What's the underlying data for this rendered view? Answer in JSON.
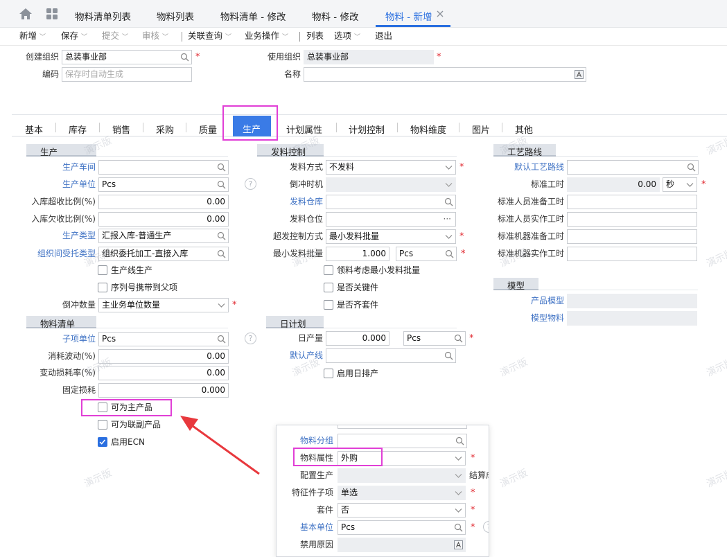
{
  "tabbar": {
    "home_icon": "home-icon",
    "apps_icon": "grid-icon",
    "tabs": [
      {
        "label": "物料清单列表"
      },
      {
        "label": "物料列表"
      },
      {
        "label": "物料清单 - 修改"
      },
      {
        "label": "物料 - 修改"
      },
      {
        "label": "物料 - 新增"
      }
    ],
    "active_color": "#2a6fe0"
  },
  "toolbar": {
    "new": "新增",
    "save": "保存",
    "submit": "提交",
    "audit": "审核",
    "related": "关联查询",
    "business": "业务操作",
    "list": "列表",
    "options": "选项",
    "exit": "退出"
  },
  "header": {
    "create_org_label": "创建组织",
    "create_org_value": "总装事业部",
    "use_org_label": "使用组织",
    "use_org_value": "总装事业部",
    "code_label": "编码",
    "code_placeholder": "保存时自动生成",
    "name_label": "名称",
    "name_value": ""
  },
  "detail_tabs": [
    "基本",
    "库存",
    "销售",
    "采购",
    "质量",
    "生产",
    "计划属性",
    "计划控制",
    "物料维度",
    "图片",
    "其他"
  ],
  "production": {
    "section": "生产",
    "workshop_label": "生产车间",
    "unit_label": "生产单位",
    "unit_value": "Pcs",
    "over_ratio_label": "入库超收比例(%)",
    "over_ratio_value": "0.00",
    "under_ratio_label": "入库欠收比例(%)",
    "under_ratio_value": "0.00",
    "type_label": "生产类型",
    "type_value": "汇报入库-普通生产",
    "inter_org_label": "组织间受托类型",
    "inter_org_value": "组织委托加工-直接入库",
    "line_prod": "生产线生产",
    "serial_carry": "序列号携带到父项",
    "backflush_qty_label": "倒冲数量",
    "backflush_qty_value": "主业务单位数量"
  },
  "bom": {
    "section": "物料清单",
    "child_unit_label": "子项单位",
    "child_unit_value": "Pcs",
    "consume_label": "消耗波动(%)",
    "consume_value": "0.00",
    "variable_loss_label": "变动损耗率(%)",
    "variable_loss_value": "0.00",
    "fixed_loss_label": "固定损耗",
    "fixed_loss_value": "0.000",
    "main_product": "可为主产品",
    "co_product": "可为联副产品",
    "enable_ecn": "启用ECN"
  },
  "issue": {
    "section": "发料控制",
    "method_label": "发料方式",
    "method_value": "不发料",
    "backflush_time_label": "倒冲时机",
    "warehouse_label": "发料仓库",
    "location_label": "发料仓位",
    "location_value": "···",
    "over_control_label": "超发控制方式",
    "over_control_value": "最小发料批量",
    "min_batch_label": "最小发料批量",
    "min_batch_value": "1.000",
    "min_batch_unit": "Pcs",
    "consider_min": "领料考虑最小发料批量",
    "is_key": "是否关键件",
    "is_kit": "是否齐套件"
  },
  "daily": {
    "section": "日计划",
    "daily_output_label": "日产量",
    "daily_output_value": "0.000",
    "daily_output_unit": "Pcs",
    "default_line_label": "默认产线",
    "enable_daily": "启用日排产"
  },
  "route": {
    "section": "工艺路线",
    "default_route_label": "默认工艺路线",
    "std_time_label": "标准工时",
    "std_time_value": "0.00",
    "std_time_unit": "秒",
    "labor_prep_label": "标准人员准备工时",
    "labor_actual_label": "标准人员实作工时",
    "machine_prep_label": "标准机器准备工时",
    "machine_actual_label": "标准机器实作工时"
  },
  "model": {
    "section": "模型",
    "product_model_label": "产品模型",
    "model_material_label": "模型物料"
  },
  "popup": {
    "group_label": "物料分组",
    "attr_label": "物料属性",
    "attr_value": "外购",
    "config_label": "配置生产",
    "settle_label": "结算成",
    "feature_label": "特征件子项",
    "feature_value": "单选",
    "kit_label": "套件",
    "kit_value": "否",
    "base_unit_label": "基本单位",
    "base_unit_value": "Pcs",
    "disable_reason_label": "禁用原因"
  },
  "watermark": "演示版",
  "colors": {
    "highlight": "#e13fd6",
    "arrow": "#e8383d",
    "link": "#3f72c4",
    "required": "#e0262d"
  }
}
